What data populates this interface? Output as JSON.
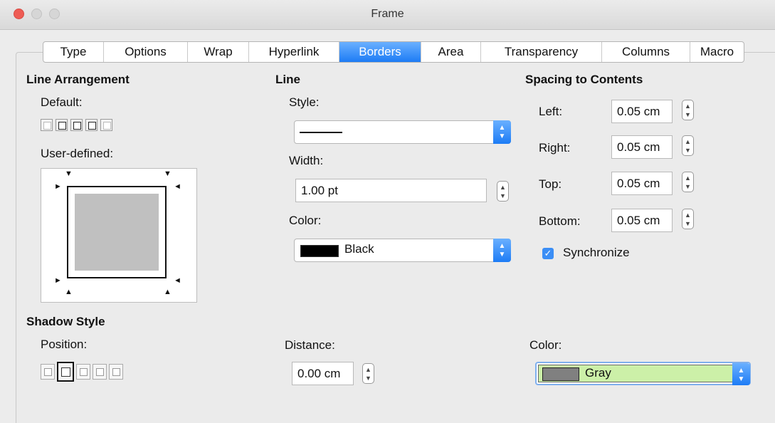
{
  "window": {
    "title": "Frame"
  },
  "tabs": [
    {
      "label": "Type",
      "active": false
    },
    {
      "label": "Options",
      "active": false
    },
    {
      "label": "Wrap",
      "active": false
    },
    {
      "label": "Hyperlink",
      "active": false
    },
    {
      "label": "Borders",
      "active": true
    },
    {
      "label": "Area",
      "active": false
    },
    {
      "label": "Transparency",
      "active": false
    },
    {
      "label": "Columns",
      "active": false
    },
    {
      "label": "Macro",
      "active": false
    }
  ],
  "line_arrangement": {
    "heading": "Line Arrangement",
    "default_label": "Default:",
    "user_defined_label": "User-defined:"
  },
  "line": {
    "heading": "Line",
    "style_label": "Style:",
    "width_label": "Width:",
    "width_value": "1.00 pt",
    "color_label": "Color:",
    "color_value": "Black",
    "color_swatch": "#000000"
  },
  "spacing": {
    "heading": "Spacing to Contents",
    "left_label": "Left:",
    "left_value": "0.05 cm",
    "right_label": "Right:",
    "right_value": "0.05 cm",
    "top_label": "Top:",
    "top_value": "0.05 cm",
    "bottom_label": "Bottom:",
    "bottom_value": "0.05 cm",
    "sync_label": "Synchronize",
    "sync_checked": true
  },
  "shadow": {
    "heading": "Shadow Style",
    "position_label": "Position:",
    "distance_label": "Distance:",
    "distance_value": "0.00 cm",
    "color_label": "Color:",
    "color_value": "Gray",
    "color_swatch": "#808080",
    "color_field_bg": "#ccf0a8"
  },
  "colors": {
    "accent": "#1d7cf5",
    "close": "#ee5c54"
  }
}
